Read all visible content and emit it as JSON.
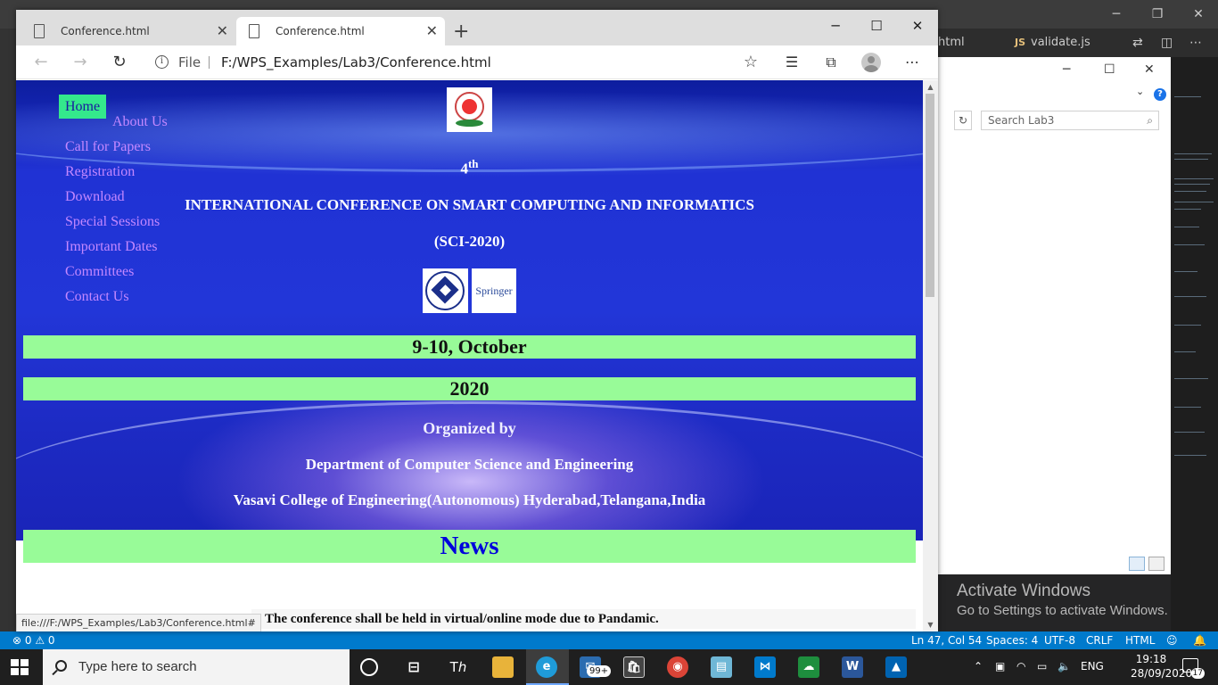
{
  "vscode": {
    "tab_html": "html",
    "tab_js_icon": "JS",
    "tab_js": "validate.js",
    "status": {
      "errors": "⊗ 0 ⚠ 0",
      "position": "Ln 47, Col 54",
      "spaces": "Spaces: 4",
      "encoding": "UTF-8",
      "eol": "CRLF",
      "language": "HTML"
    }
  },
  "explorer": {
    "search_placeholder": "Search Lab3"
  },
  "activation": {
    "title": "Activate Windows",
    "subtitle": "Go to Settings to activate Windows."
  },
  "browser": {
    "tabs": [
      {
        "title": "Conference.html"
      },
      {
        "title": "Conference.html"
      }
    ],
    "address": {
      "scheme_label": "File",
      "url": "F:/WPS_Examples/Lab3/Conference.html"
    },
    "status_url": "file:///F:/WPS_Examples/Lab3/Conference.html#"
  },
  "page": {
    "nav": {
      "home": "Home",
      "about": "About Us",
      "call": "Call for Papers",
      "registration": "Registration",
      "download": "Download",
      "special": "Special Sessions",
      "dates": "Important Dates",
      "committees": "Committees",
      "contact": "Contact Us"
    },
    "ordinal_number": "4",
    "ordinal_suffix": "th",
    "conference_title": "INTERNATIONAL CONFERENCE ON SMART COMPUTING AND INFORMATICS",
    "conference_abbr": "(SCI-2020)",
    "springer_logo": "Springer",
    "date": "9-10, October",
    "year": "2020",
    "organized_by": "Organized by",
    "department": "Department of Computer Science and Engineering",
    "college": "Vasavi College of Engineering(Autonomous) Hyderabad,Telangana,India",
    "news_heading": "News",
    "news_item": "* The conference shall be held in virtual/online mode due to Pandamic."
  },
  "taskbar": {
    "search_placeholder": "Type here to search",
    "mail_badge": "99+",
    "language": "ENG",
    "time": "19:18",
    "date": "28/09/2020",
    "notifications": "17"
  }
}
